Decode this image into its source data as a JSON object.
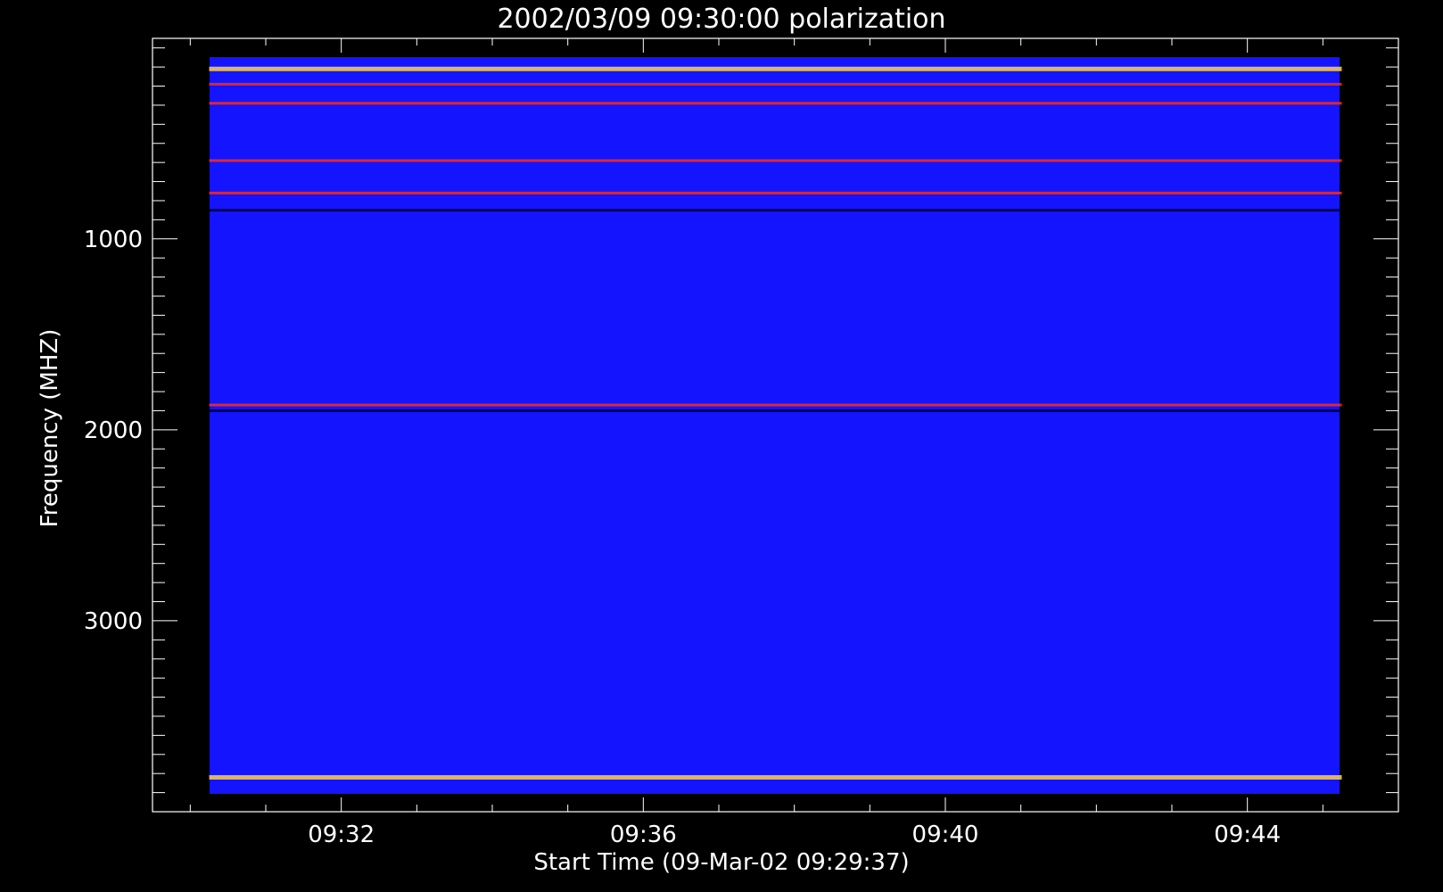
{
  "chart_data": {
    "type": "heatmap",
    "title": "2002/03/09 09:30:00 polarization",
    "xlabel": "Start Time (09-Mar-02 09:29:37)",
    "ylabel": "Frequency (MHZ)",
    "x_tick_labels": [
      "09:32",
      "09:36",
      "09:40",
      "09:44"
    ],
    "x_tick_minutes": [
      2,
      6,
      10,
      14
    ],
    "xlim_minutes": [
      -0.5,
      16
    ],
    "data_xlim_minutes": [
      0.25,
      15.25
    ],
    "y_tick_labels": [
      "1000",
      "2000",
      "3000"
    ],
    "y_tick_values": [
      1000,
      2000,
      3000
    ],
    "ylim": [
      -50,
      4000
    ],
    "data_ylim": [
      50,
      3920
    ],
    "y_inverted": true,
    "grid": false,
    "colors": {
      "background": "#000000",
      "field": "#1414ff",
      "hot": "#ff2a10",
      "bright": "#ffd24a",
      "dark": "#000030"
    },
    "bands": [
      {
        "freq": 110,
        "kind": "bright"
      },
      {
        "freq": 190,
        "kind": "hot"
      },
      {
        "freq": 290,
        "kind": "hot"
      },
      {
        "freq": 590,
        "kind": "hot"
      },
      {
        "freq": 760,
        "kind": "hot"
      },
      {
        "freq": 850,
        "kind": "dark"
      },
      {
        "freq": 1870,
        "kind": "hot"
      },
      {
        "freq": 1900,
        "kind": "dark"
      },
      {
        "freq": 3820,
        "kind": "bright"
      }
    ]
  }
}
